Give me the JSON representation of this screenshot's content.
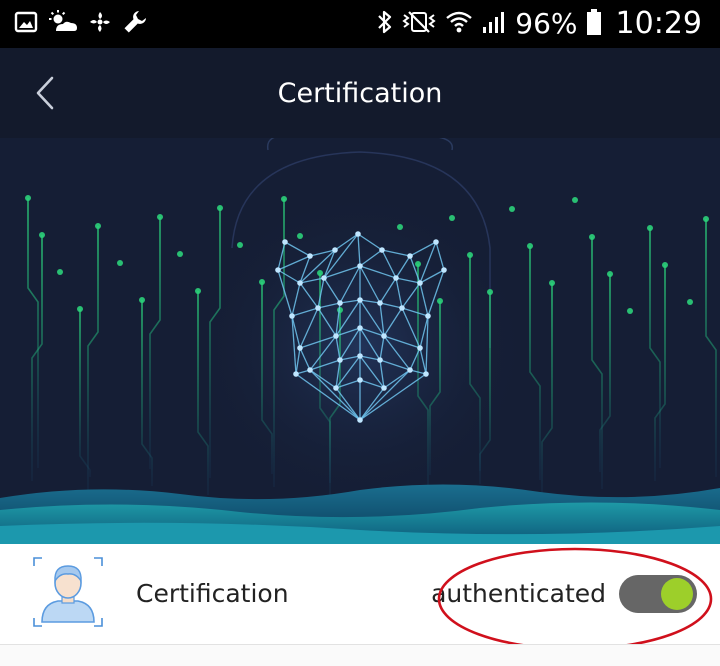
{
  "status_bar": {
    "battery": "96%",
    "time": "10:29",
    "left_icons": [
      "gallery-icon",
      "weather-icon",
      "fan-icon",
      "wrench-icon"
    ],
    "right_icons": [
      "bluetooth-icon",
      "vibrate-icon",
      "wifi-icon",
      "signal-icon",
      "battery-icon"
    ]
  },
  "header": {
    "title": "Certification",
    "back_icon": "chevron-left-icon"
  },
  "hero": {
    "illustration": "face-mesh-icon"
  },
  "certification": {
    "label": "Certification",
    "status": "authenticated",
    "toggle_on": true,
    "avatar_icon": "user-avatar-icon"
  },
  "colors": {
    "header_bg": "#131a2c",
    "hero_bg": "#151e35",
    "toggle_track": "#666666",
    "toggle_knob": "#9dcf2a",
    "highlight": "#d0101c",
    "mesh": "#6fc4ee"
  }
}
